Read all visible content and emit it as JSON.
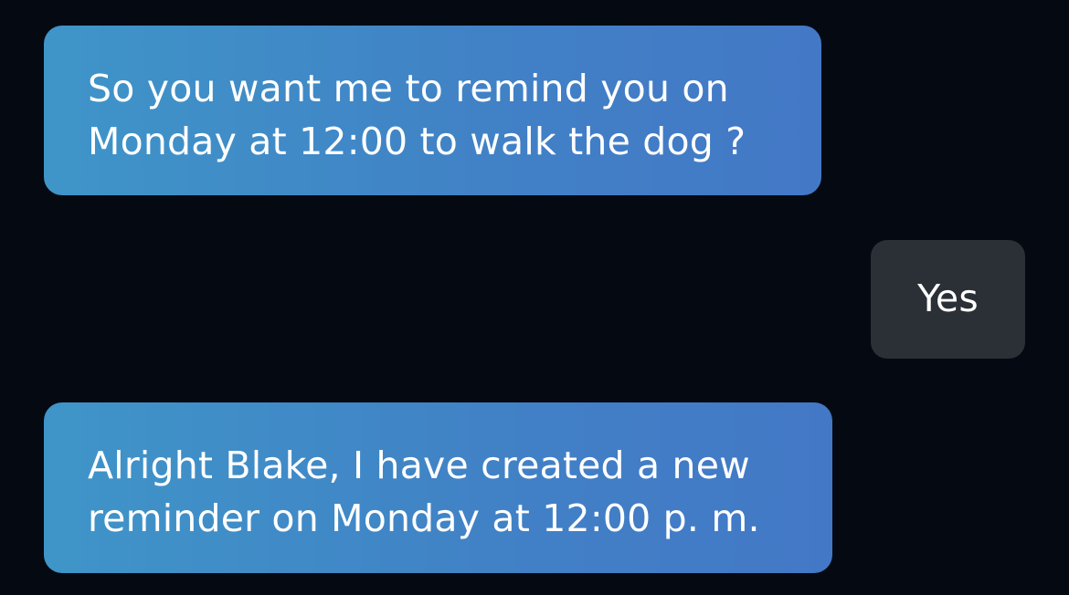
{
  "conversation": {
    "messages": [
      {
        "sender": "assistant",
        "lines": [
          "So you want me to remind you on",
          "Monday at 12:00 to walk the dog ?"
        ]
      },
      {
        "sender": "user",
        "lines": [
          "Yes"
        ]
      },
      {
        "sender": "assistant",
        "lines": [
          "Alright Blake, I have created a new",
          "reminder on Monday at 12:00 p. m."
        ]
      }
    ]
  },
  "colors": {
    "background": "#050a12",
    "assistant_bubble_start": "#3f95c8",
    "assistant_bubble_end": "#4378c6",
    "user_bubble": "#2b2f36",
    "text": "#ffffff"
  }
}
